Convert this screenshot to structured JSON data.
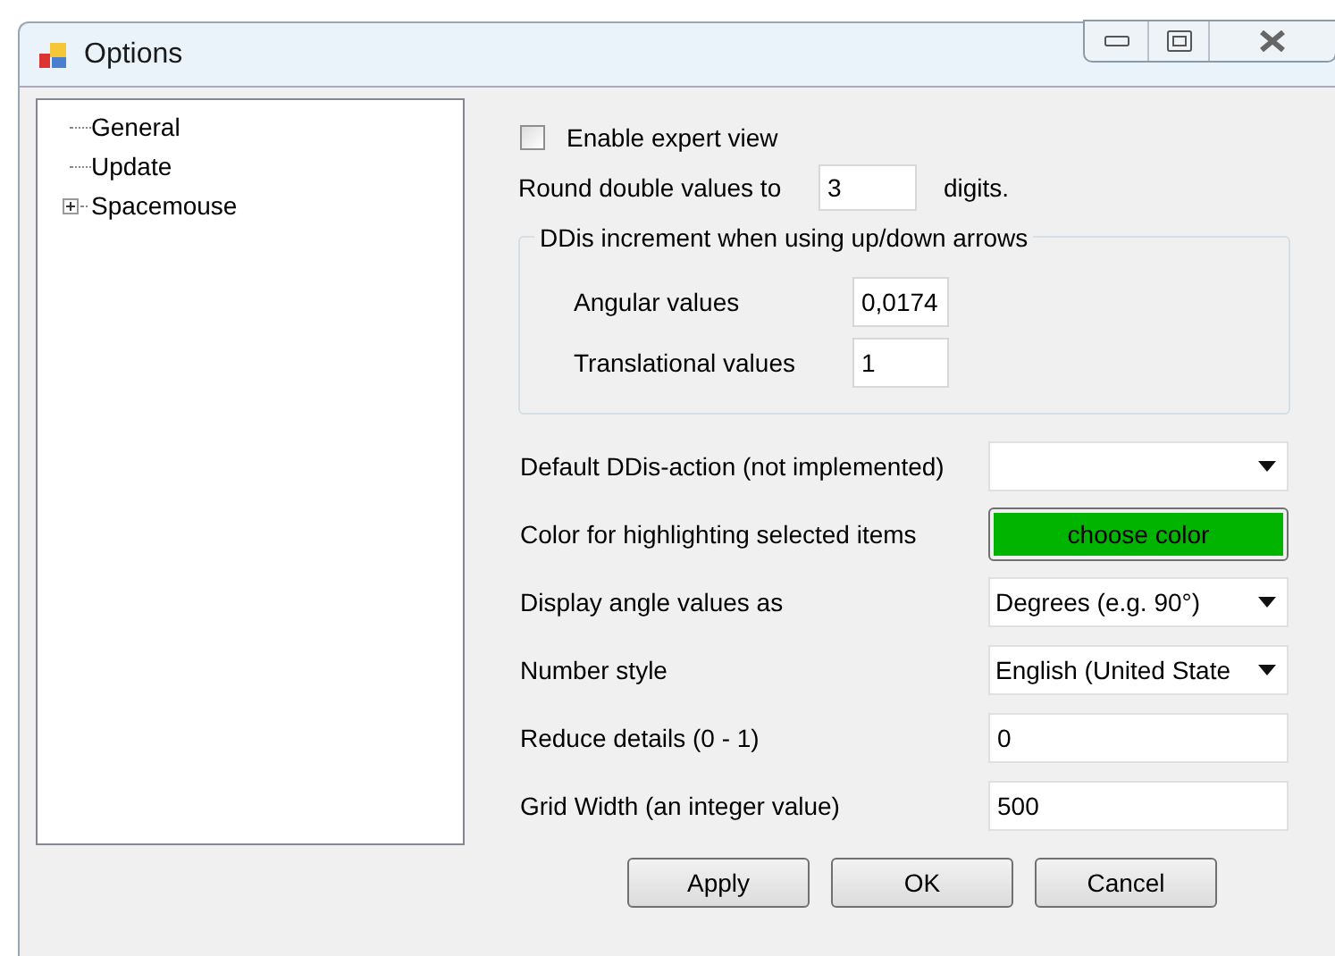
{
  "window": {
    "title": "Options"
  },
  "tree": [
    {
      "label": "General"
    },
    {
      "label": "Update"
    },
    {
      "label": "Spacemouse",
      "expanded": false
    }
  ],
  "expert_view": {
    "label": "Enable expert view",
    "checked": false
  },
  "round": {
    "label": "Round double values to",
    "value": "3",
    "unit": "digits."
  },
  "increment_group": {
    "title": "DDis increment when using up/down arrows",
    "rows": [
      {
        "label": "Angular values",
        "value": "0,0174"
      },
      {
        "label": "Translational values",
        "value": "1"
      }
    ]
  },
  "settings": [
    {
      "kind": "dropdown",
      "label": "Default DDis-action (not implemented)"
    },
    {
      "kind": "color",
      "label": "Color for highlighting selected items",
      "value": "choose color",
      "color": "#00b400"
    },
    {
      "kind": "dropdown",
      "label": "Display angle values as",
      "value": "Degrees (e.g. 90°)"
    },
    {
      "kind": "dropdown",
      "label": "Number style",
      "value": "English (United State"
    },
    {
      "kind": "text",
      "label": "Reduce details  (0 - 1)",
      "value": "0"
    },
    {
      "kind": "text",
      "label": "Grid Width (an integer value)",
      "value": "500"
    }
  ],
  "buttons": [
    "Apply",
    "OK",
    "Cancel"
  ]
}
